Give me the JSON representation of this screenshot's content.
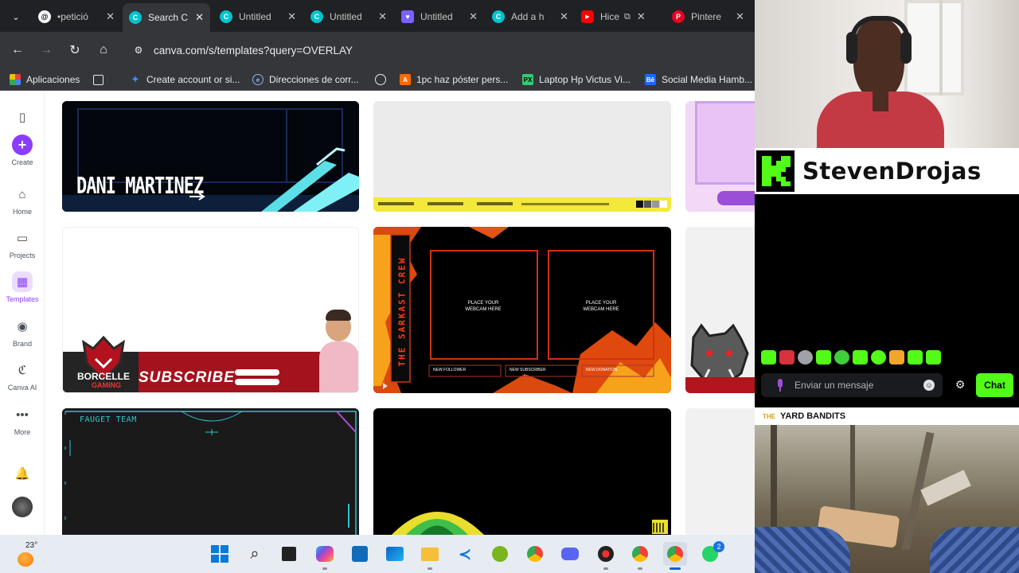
{
  "browser": {
    "tabs": [
      {
        "title": "•petició",
        "icon": "threads-icon",
        "color": "#000000"
      },
      {
        "title": "Search C",
        "icon": "canva-icon",
        "color": "#00c4cc",
        "active": true
      },
      {
        "title": "Untitled",
        "icon": "canva-icon",
        "color": "#00c4cc"
      },
      {
        "title": "Untitled",
        "icon": "canva-icon",
        "color": "#00c4cc"
      },
      {
        "title": "Untitled",
        "icon": "heart-icon",
        "color": "#7b61ff"
      },
      {
        "title": "Add a h",
        "icon": "canva-icon",
        "color": "#00c4cc"
      },
      {
        "title": "Hice",
        "icon": "youtube-icon",
        "color": "#ff0000"
      },
      {
        "title": "Pintere",
        "icon": "pinterest-icon",
        "color": "#e60023"
      }
    ],
    "url": "canva.com/s/templates?query=OVERLAY",
    "bookmarks": [
      {
        "label": "Aplicaciones",
        "icon": "apps-grid-icon"
      },
      {
        "label": "",
        "icon": "tab-groups-icon"
      },
      {
        "label": "Create account or si...",
        "icon": "gemini-star-icon"
      },
      {
        "label": "Direcciones de corr...",
        "icon": "directions-icon"
      },
      {
        "label": "",
        "icon": "globe-icon"
      },
      {
        "label": "1pc haz póster pers...",
        "icon": "aliexpress-icon"
      },
      {
        "label": "Laptop Hp Victus Vi...",
        "icon": "px-icon"
      },
      {
        "label": "Social Media Hamb...",
        "icon": "behance-icon"
      }
    ]
  },
  "canva": {
    "sidebar": [
      {
        "label": "",
        "icon": "panel-toggle-icon"
      },
      {
        "label": "Create",
        "icon": "plus-icon"
      },
      {
        "label": "Home",
        "icon": "home-icon"
      },
      {
        "label": "Projects",
        "icon": "folder-icon"
      },
      {
        "label": "Templates",
        "icon": "templates-icon"
      },
      {
        "label": "Brand",
        "icon": "brand-icon"
      },
      {
        "label": "Canva AI",
        "icon": "canva-ai-icon"
      },
      {
        "label": "More",
        "icon": "more-dots-icon"
      },
      {
        "label": "",
        "icon": "bell-icon"
      },
      {
        "label": "",
        "icon": "avatar"
      }
    ],
    "cards": {
      "dani": {
        "name": "DANI MARTINEZ"
      },
      "borcelle": {
        "brand": "BORCELLE",
        "brand_sub": "GAMING",
        "cta": "SUBSCRIBE"
      },
      "sarkast": {
        "crew": "THE SARKAST CREW",
        "cam1": "PLACE YOUR WEBCAM HERE",
        "cam2": "PLACE YOUR WEBCAM HERE",
        "f1": "NEW FOLLOWER",
        "f2": "NEW SUBSCRIBER",
        "f3": "NEW DONATION"
      },
      "fauget": {
        "team": "FAUGET TEAM"
      }
    }
  },
  "stream": {
    "streamer": "StevenDrojas",
    "chat_placeholder": "Enviar un mensaje",
    "chat_button": "Chat",
    "video_title": "YARD BANDITS",
    "video_title_prefix": "THE"
  },
  "taskbar": {
    "temperature": "23°",
    "apps": [
      "windows-start-icon",
      "search-icon",
      "file-explorer-dark-icon",
      "m365-icon",
      "calculator-icon",
      "outlook-icon",
      "folder-icon",
      "vscode-icon",
      "utorrent-icon",
      "chrome-icon",
      "discord-icon",
      "davinci-icon",
      "chrome-profile-icon",
      "chrome-active-icon",
      "whatsapp-icon"
    ],
    "whatsapp_badge": "2"
  }
}
